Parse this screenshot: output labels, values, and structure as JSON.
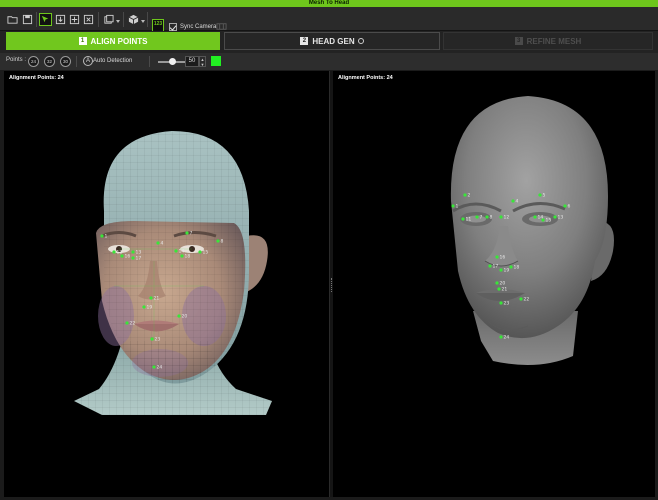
{
  "window": {
    "title": "Mesh To Head"
  },
  "toolbar": {
    "icons": [
      "folder-open-icon",
      "save-icon",
      "select-point-icon",
      "import-icon",
      "move-point-icon",
      "transform-icon",
      "layers-icon",
      "cube-view-icon",
      "point-numbers-icon"
    ],
    "badge_label": "123",
    "sync_camera_label": "Sync Camera",
    "sync_camera_checked": true
  },
  "steps": [
    {
      "num": "1",
      "label": "ALIGN POINTS",
      "state": "active"
    },
    {
      "num": "2",
      "label": "HEAD GEN",
      "state": "normal"
    },
    {
      "num": "3",
      "label": "REFINE MESH",
      "state": "disabled"
    }
  ],
  "options": {
    "points_label": "Points :",
    "point_presets": [
      "24",
      "32",
      "30"
    ],
    "auto_detection_label": "Auto Detection",
    "slider_value": "50",
    "slider_fraction": 0.5,
    "swatch_color": "#22f022"
  },
  "viewports": {
    "left": {
      "title": "Alignment Points: 24"
    },
    "right": {
      "title": "Alignment Points: 24"
    }
  },
  "colors": {
    "accent": "#71c71e",
    "point_color": "#39e639"
  },
  "left_points": [
    "1",
    "4",
    "7",
    "8",
    "12",
    "13",
    "14",
    "15",
    "16",
    "17",
    "18",
    "19",
    "20",
    "21",
    "22",
    "23",
    "24"
  ],
  "right_points": [
    "1",
    "2",
    "4",
    "5",
    "6",
    "7",
    "8",
    "11",
    "12",
    "13",
    "14",
    "15",
    "16",
    "17",
    "18",
    "19",
    "20",
    "21",
    "22",
    "23",
    "24"
  ]
}
